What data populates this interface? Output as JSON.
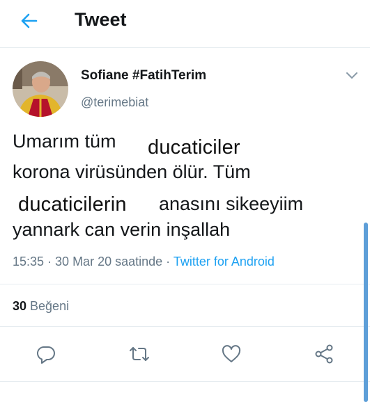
{
  "header": {
    "title": "Tweet"
  },
  "tweet": {
    "display_name": "Sofiane #FatihTerim",
    "handle": "@terimebiat",
    "lines": [
      "Umarım tüm",
      "korona virüsünden ölür. Tüm",
      "anasını sikeeyiim",
      "yannark can verin inşallah"
    ],
    "pasted_words": [
      "ducaticiler",
      "ducaticilerin"
    ],
    "time": "15:35 · 30 Mar 20 saatinde · ",
    "source": "Twitter for Android",
    "likes_count": "30",
    "likes_label": " Beğeni"
  },
  "icons": {
    "back": "arrow-left-icon",
    "more": "chevron-down-icon",
    "reply": "reply-icon",
    "retweet": "retweet-icon",
    "like": "heart-icon",
    "share": "share-icon"
  },
  "colors": {
    "accent": "#1da1f2",
    "muted": "#657786",
    "divider": "#e6ecf0"
  }
}
